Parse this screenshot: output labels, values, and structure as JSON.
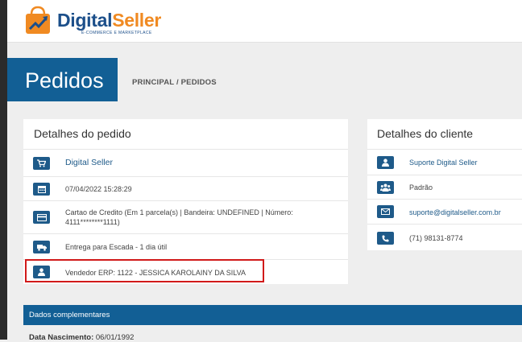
{
  "brand": {
    "name_part1": "Digital",
    "name_part2": "Seller",
    "tagline": "E-COMMERCE E MARKETPLACE"
  },
  "page": {
    "title": "Pedidos",
    "breadcrumb": "PRINCIPAL / PEDIDOS"
  },
  "order": {
    "heading": "Detalhes do pedido",
    "store": "Digital Seller",
    "date": "07/04/2022 15:28:29",
    "payment_line1": "Cartao de Credito (Em 1 parcela(s) | Bandeira: UNDEFINED | Número:",
    "payment_line2": "4111********1111)",
    "shipping": "Entrega para Escada - 1 dia útil",
    "seller": "Vendedor ERP: 1122 - JESSICA KAROLAINY DA SILVA"
  },
  "client": {
    "heading": "Detalhes do cliente",
    "name": "Suporte Digital Seller",
    "group": "Padrão",
    "email": "suporte@digitalseller.com.br",
    "phone": "(71) 98131-8774"
  },
  "extra": {
    "heading": "Dados complementares",
    "birth_label": "Data Nascimento:",
    "birth_value": "06/01/1992"
  },
  "icons": [
    "cart-icon",
    "calendar-icon",
    "credit-card-icon",
    "truck-icon",
    "user-icon",
    "users-icon",
    "envelope-icon",
    "phone-icon"
  ],
  "colors": {
    "primary": "#125f95",
    "brand_blue": "#1c4f8a",
    "brand_orange": "#f08a22",
    "highlight_red": "#d11a1a"
  }
}
